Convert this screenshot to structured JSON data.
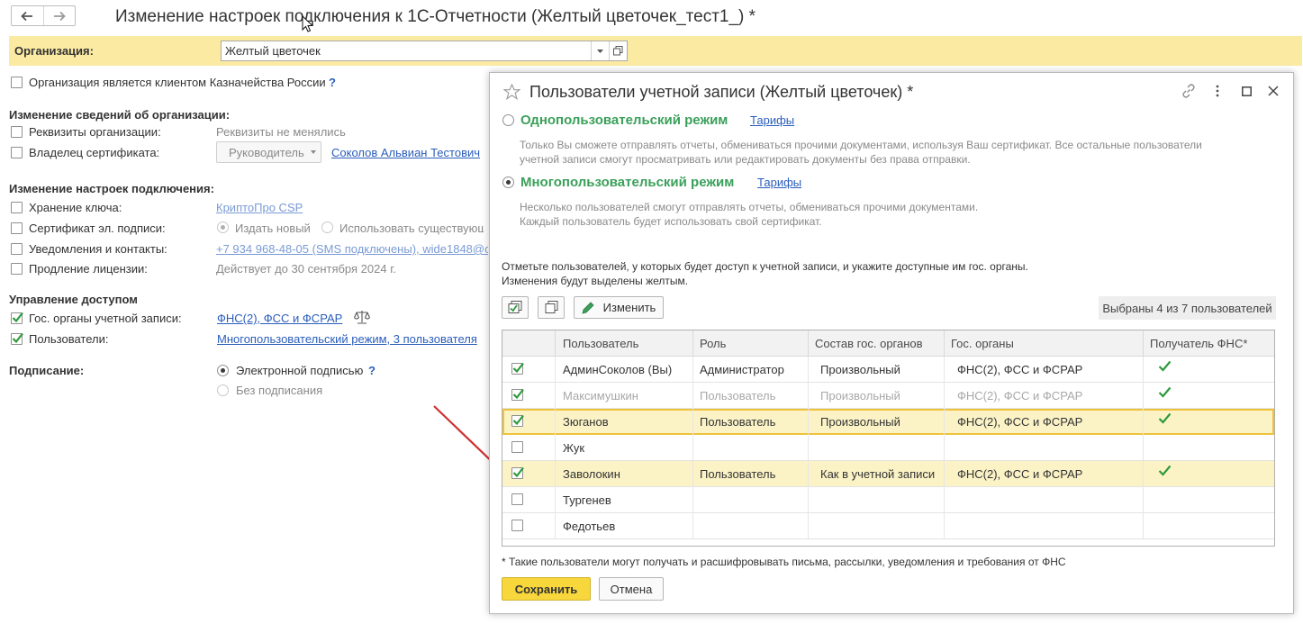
{
  "window": {
    "title": "Изменение настроек подключения к 1С-Отчетности (Желтый цветочек_тест1_) *"
  },
  "organization": {
    "label": "Организация:",
    "value": "Желтый цветочек"
  },
  "treasury": {
    "label": "Организация является клиентом Казначейства России",
    "help": "?"
  },
  "org_changes": {
    "title": "Изменение сведений об организации:",
    "details_label": "Реквизиты организации:",
    "details_value": "Реквизиты не менялись",
    "owner_label": "Владелец сертификата:",
    "owner_role": "Руководитель",
    "owner_name": "Соколов Альвиан Тестович"
  },
  "conn_changes": {
    "title": "Изменение настроек подключения:",
    "key_label": "Хранение ключа:",
    "key_value": "КриптоПро CSP",
    "cert_label": "Сертификат эл. подписи:",
    "cert_new": "Издать новый",
    "cert_existing": "Использовать существующ",
    "notify_label": "Уведомления и контакты:",
    "notify_value": "+7 934 968-48-05 (SMS подключены), wide1848@c",
    "license_label": "Продление лицензии:",
    "license_value": "Действует до 30 сентября 2024 г."
  },
  "access": {
    "title": "Управление доступом",
    "gov_label": "Гос. органы учетной записи:",
    "gov_value": "ФНС(2), ФСС и ФСРАР",
    "users_label": "Пользователи:",
    "users_value": "Многопользовательский режим, 3 пользователя"
  },
  "signing": {
    "title": "Подписание:",
    "option1": "Электронной подписью",
    "help": "?",
    "option2": "Без подписания"
  },
  "dialog": {
    "title": "Пользователи учетной записи (Желтый цветочек) *",
    "single_mode": {
      "title": "Однопользовательский режим",
      "link": "Тарифы",
      "desc_line1": "Только Вы сможете отправлять отчеты, обмениваться прочими документами, используя Ваш сертификат. Все остальные пользователи",
      "desc_line2": "учетной записи смогут просматривать или редактировать документы без права отправки."
    },
    "multi_mode": {
      "title": "Многопользовательский режим",
      "link": "Тарифы",
      "desc_line1": "Несколько пользователей смогут отправлять отчеты, обмениваться прочими документами.",
      "desc_line2": "Каждый пользователь будет использовать свой сертификат."
    },
    "instruction_line1": "Отметьте пользователей, у которых будет доступ к учетной записи, и укажите доступные им гос. органы.",
    "instruction_line2": "Изменения будут выделены желтым.",
    "edit_button": "Изменить",
    "selected_counter": "Выбраны 4 из 7 пользователей",
    "columns": [
      "Пользователь",
      "Роль",
      "Состав гос. органов",
      "Гос. органы",
      "Получатель ФНС*"
    ],
    "rows": [
      {
        "checked": true,
        "user": "АдминСоколов (Вы)",
        "role": "Администратор",
        "composition": "Произвольный",
        "orgs": "ФНС(2), ФСС и ФСРАР",
        "fns": true,
        "dim": false,
        "state": "normal"
      },
      {
        "checked": true,
        "user": "Максимушкин",
        "role": "Пользователь",
        "composition": "Произвольный",
        "orgs": "ФНС(2), ФСС и ФСРАР",
        "fns": true,
        "dim": true,
        "state": "normal"
      },
      {
        "checked": true,
        "user": "Зюганов",
        "role": "Пользователь",
        "composition": "Произвольный",
        "orgs": "ФНС(2), ФСС и ФСРАР",
        "fns": true,
        "dim": false,
        "state": "selected"
      },
      {
        "checked": false,
        "user": "Жук",
        "role": "",
        "composition": "",
        "orgs": "",
        "fns": false,
        "dim": false,
        "state": "normal"
      },
      {
        "checked": true,
        "user": "Заволокин",
        "role": "Пользователь",
        "composition": "Как в учетной записи",
        "orgs": "ФНС(2), ФСС и ФСРАР",
        "fns": true,
        "dim": false,
        "state": "highlight"
      },
      {
        "checked": false,
        "user": "Тургенев",
        "role": "",
        "composition": "",
        "orgs": "",
        "fns": false,
        "dim": false,
        "state": "normal"
      },
      {
        "checked": false,
        "user": "Федотьев",
        "role": "",
        "composition": "",
        "orgs": "",
        "fns": false,
        "dim": false,
        "state": "normal"
      }
    ],
    "footnote": "* Такие пользователи могут получать и расшифровывать письма, рассылки, уведомления и требования от ФНС",
    "save_button": "Сохранить",
    "cancel_button": "Отмена"
  },
  "colors": {
    "accent_yellow": "#f7d73c",
    "org_bar": "#fbeaa2",
    "row_highlight": "#fbf3c6",
    "mode_green": "#3aa05a",
    "check_green": "#2e9a3c",
    "link_blue": "#2a5dbb",
    "arrow_red": "#d03030"
  },
  "icons": [
    "back-arrow-icon",
    "forward-arrow-icon",
    "open-form-icon",
    "scales-icon",
    "star-icon",
    "link-icon",
    "more-icon",
    "maximize-icon",
    "close-icon",
    "check-all-icon",
    "copy-icon",
    "pencil-icon",
    "checkmark-icon"
  ]
}
